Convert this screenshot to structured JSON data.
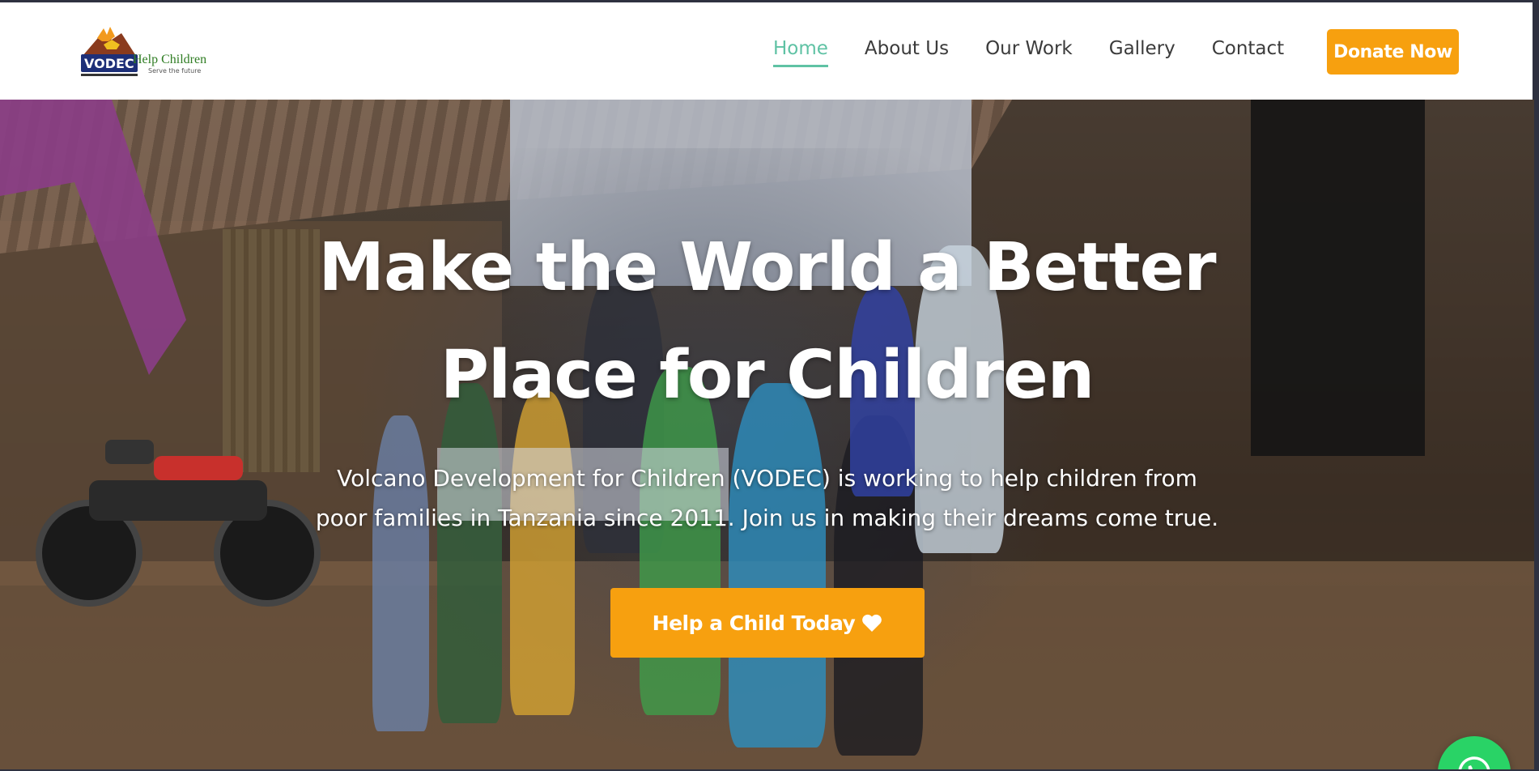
{
  "header": {
    "logo": {
      "mark_text": "VODEC",
      "name": "Help Children",
      "tagline": "Serve the future"
    },
    "nav": [
      {
        "label": "Home",
        "active": true
      },
      {
        "label": "About Us",
        "active": false
      },
      {
        "label": "Our Work",
        "active": false
      },
      {
        "label": "Gallery",
        "active": false
      },
      {
        "label": "Contact",
        "active": false
      }
    ],
    "donate_label": "Donate Now"
  },
  "hero": {
    "title_line1": "Make the World a Better",
    "title_line2": "Place for Children",
    "subtitle_line1": "Volcano Development for Children (VODEC) is working to help children from",
    "subtitle_line2": "poor families in Tanzania since 2011. Join us in making their dreams come true.",
    "cta_label": "Help a Child Today",
    "cta_icon": "heart-icon"
  },
  "floating": {
    "whatsapp_icon": "whatsapp-icon"
  },
  "colors": {
    "accent_orange": "#f7a00f",
    "nav_active": "#5fc2a4",
    "whatsapp_green": "#29d366"
  }
}
